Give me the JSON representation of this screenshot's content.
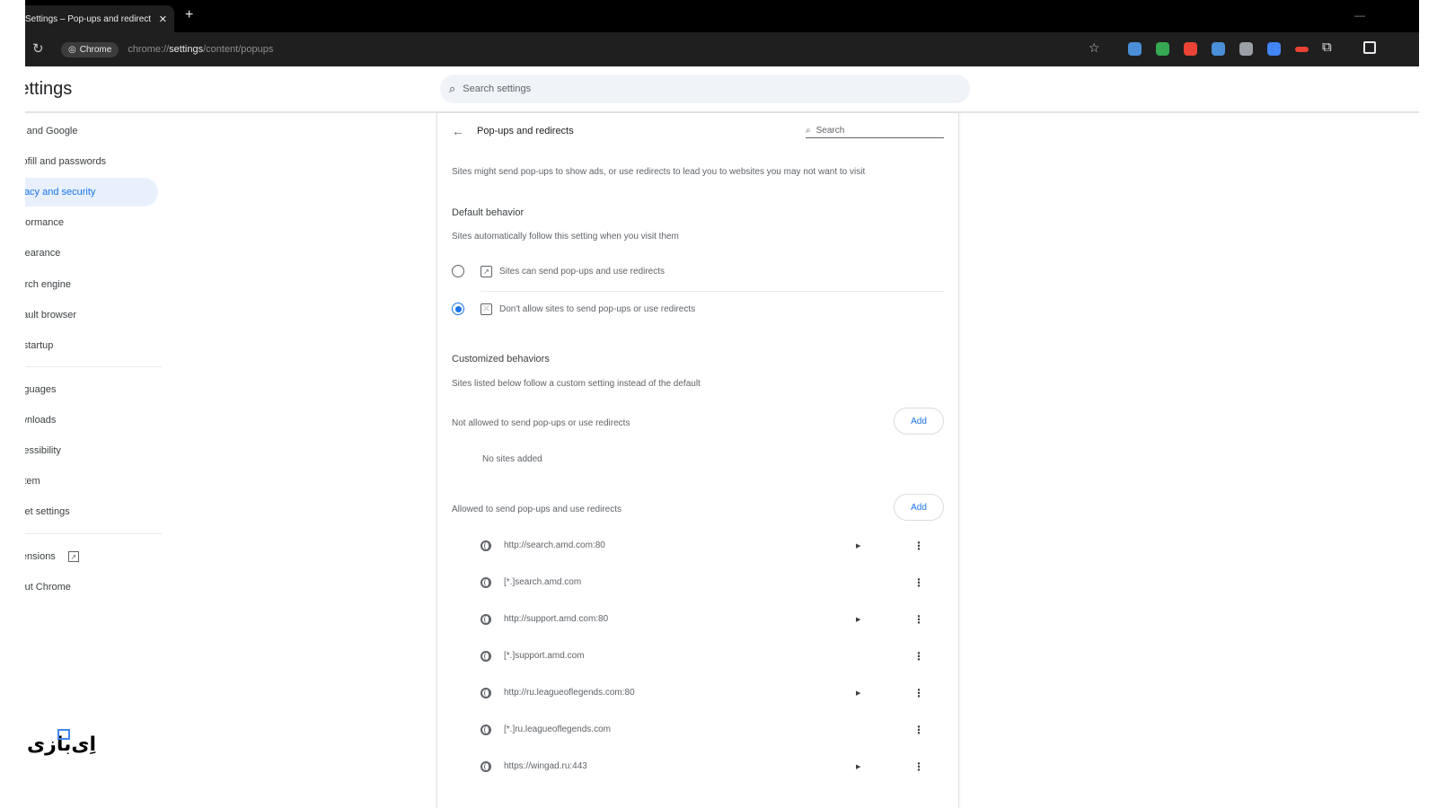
{
  "browser": {
    "tab_title": "Settings – Pop-ups and redirects",
    "tab_close": "✕",
    "new_tab": "+",
    "minimize": "—",
    "chip_label": "Chrome",
    "url_prefix": "chrome://",
    "url_bold": "settings",
    "url_suffix": "/content/popups",
    "extension_colors": [
      "#4a90d9",
      "#34a853",
      "#ea4335",
      "#4a90d9",
      "#9aa0a6",
      "#4285f4",
      "#ea4335"
    ]
  },
  "header": {
    "title": "Settings",
    "search_placeholder": "Search settings"
  },
  "sidebar": {
    "items": [
      {
        "label": "You and Google",
        "active": false
      },
      {
        "label": "Autofill and passwords",
        "active": false
      },
      {
        "label": "Privacy and security",
        "active": true
      },
      {
        "label": "Performance",
        "active": false
      },
      {
        "label": "Appearance",
        "active": false
      },
      {
        "label": "Search engine",
        "active": false
      },
      {
        "label": "Default browser",
        "active": false
      },
      {
        "label": "On startup",
        "active": false
      },
      {
        "label": "Languages",
        "active": false
      },
      {
        "label": "Downloads",
        "active": false
      },
      {
        "label": "Accessibility",
        "active": false
      },
      {
        "label": "System",
        "active": false
      },
      {
        "label": "Reset settings",
        "active": false
      },
      {
        "label": "Extensions",
        "active": false
      },
      {
        "label": "About Chrome",
        "active": false
      }
    ]
  },
  "main": {
    "page_title": "Pop-ups and redirects",
    "search_placeholder": "Search",
    "description": "Sites might send pop-ups to show ads, or use redirects to lead you to websites you may not want to visit",
    "default_behavior": {
      "heading": "Default behavior",
      "subtitle": "Sites automatically follow this setting when you visit them",
      "options": [
        {
          "label": "Sites can send pop-ups and use redirects",
          "checked": false
        },
        {
          "label": "Don't allow sites to send pop-ups or use redirects",
          "checked": true
        }
      ]
    },
    "customized": {
      "heading": "Customized behaviors",
      "subtitle": "Sites listed below follow a custom setting instead of the default",
      "not_allowed_label": "Not allowed to send pop-ups or use redirects",
      "add_label": "Add",
      "no_sites": "No sites added",
      "allowed_label": "Allowed to send pop-ups and use redirects",
      "sites": [
        {
          "url": "http://search.amd.com:80",
          "expand": true
        },
        {
          "url": "[*.]search.amd.com",
          "expand": false
        },
        {
          "url": "http://support.amd.com:80",
          "expand": true
        },
        {
          "url": "[*.]support.amd.com",
          "expand": false
        },
        {
          "url": "http://ru.leagueoflegends.com:80",
          "expand": true
        },
        {
          "url": "[*.]ru.leagueoflegends.com",
          "expand": false
        },
        {
          "url": "https://wingad.ru:443",
          "expand": true
        }
      ]
    }
  },
  "brand": {
    "logo_text": "اِی‌بازی"
  }
}
